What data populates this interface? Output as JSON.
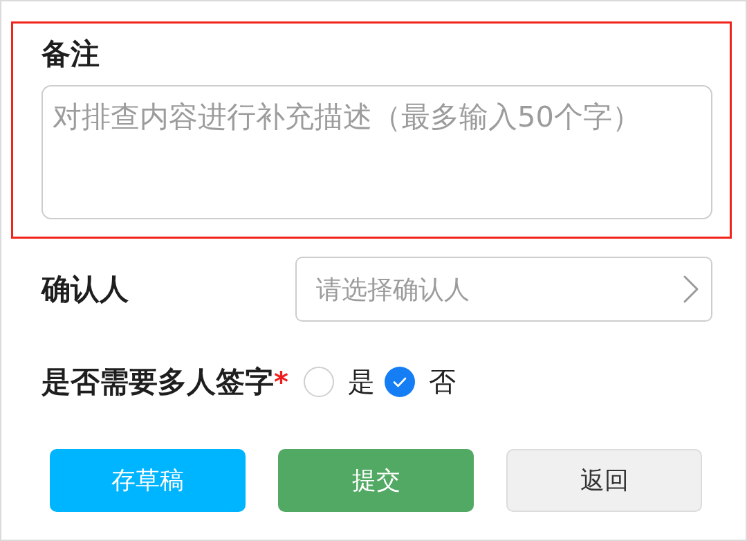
{
  "remarks": {
    "label": "备注",
    "placeholder": "对排查内容进行补充描述（最多输入50个字）",
    "highlighted": true
  },
  "confirmer": {
    "label": "确认人",
    "placeholder": "请选择确认人"
  },
  "multi_sign": {
    "label": "是否需要多人签字",
    "required_mark": "*",
    "options": [
      {
        "label": "是",
        "selected": false
      },
      {
        "label": "否",
        "selected": true
      }
    ]
  },
  "buttons": [
    {
      "label": "存草稿",
      "kind": "primary"
    },
    {
      "label": "提交",
      "kind": "success"
    },
    {
      "label": "返回",
      "kind": "default"
    }
  ]
}
